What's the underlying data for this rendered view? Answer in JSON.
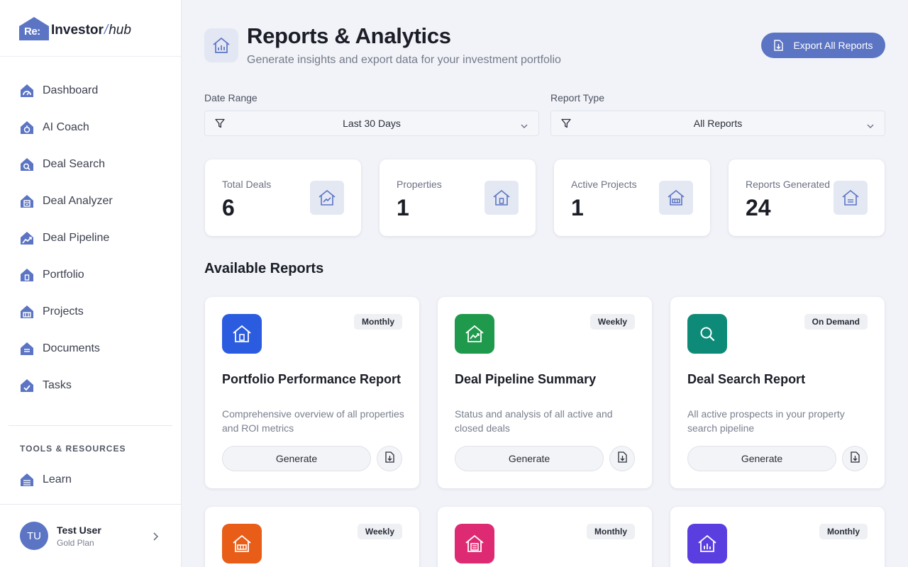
{
  "brand": {
    "prefix": "Re:",
    "name": "Investor",
    "slash": "/",
    "suffix": "hub"
  },
  "sidebar": {
    "items": [
      {
        "label": "Dashboard",
        "icon": "gauge-house-icon"
      },
      {
        "label": "AI Coach",
        "icon": "ai-house-icon"
      },
      {
        "label": "Deal Search",
        "icon": "search-house-icon"
      },
      {
        "label": "Deal Analyzer",
        "icon": "calculator-house-icon"
      },
      {
        "label": "Deal Pipeline",
        "icon": "trend-house-icon"
      },
      {
        "label": "Portfolio",
        "icon": "portfolio-house-icon"
      },
      {
        "label": "Projects",
        "icon": "projects-house-icon"
      },
      {
        "label": "Documents",
        "icon": "documents-house-icon"
      },
      {
        "label": "Tasks",
        "icon": "tasks-house-icon"
      }
    ],
    "section_title": "TOOLS & RESOURCES",
    "learn": {
      "label": "Learn",
      "icon": "learn-house-icon"
    },
    "user": {
      "initials": "TU",
      "name": "Test User",
      "plan": "Gold Plan"
    }
  },
  "header": {
    "title": "Reports & Analytics",
    "subtitle": "Generate insights and export data for your investment portfolio",
    "export_label": "Export All Reports"
  },
  "filters": {
    "date_range": {
      "label": "Date Range",
      "value": "Last 30 Days"
    },
    "report_type": {
      "label": "Report Type",
      "value": "All Reports"
    }
  },
  "stats": [
    {
      "label": "Total Deals",
      "value": "6",
      "icon": "trend-house-icon"
    },
    {
      "label": "Properties",
      "value": "1",
      "icon": "property-house-icon"
    },
    {
      "label": "Active Projects",
      "value": "1",
      "icon": "projects-house-icon"
    },
    {
      "label": "Reports Generated",
      "value": "24",
      "icon": "document-house-icon"
    }
  ],
  "reports_section_title": "Available Reports",
  "reports": [
    {
      "title": "Portfolio Performance Report",
      "frequency": "Monthly",
      "description": "Comprehensive overview of all properties and ROI metrics",
      "color": "#2b5ce0",
      "icon": "portfolio-house-icon"
    },
    {
      "title": "Deal Pipeline Summary",
      "frequency": "Weekly",
      "description": "Status and analysis of all active and closed deals",
      "color": "#1f9a4c",
      "icon": "trend-house-icon"
    },
    {
      "title": "Deal Search Report",
      "frequency": "On Demand",
      "description": "All active prospects in your property search pipeline",
      "color": "#0e8a78",
      "icon": "search-icon"
    },
    {
      "title": "",
      "frequency": "Weekly",
      "description": "",
      "color": "#e85d17",
      "icon": "projects-house-icon"
    },
    {
      "title": "",
      "frequency": "Monthly",
      "description": "",
      "color": "#de2a72",
      "icon": "document-house-icon"
    },
    {
      "title": "",
      "frequency": "Monthly",
      "description": "",
      "color": "#5a3ee0",
      "icon": "chart-house-icon"
    }
  ],
  "generate_label": "Generate"
}
